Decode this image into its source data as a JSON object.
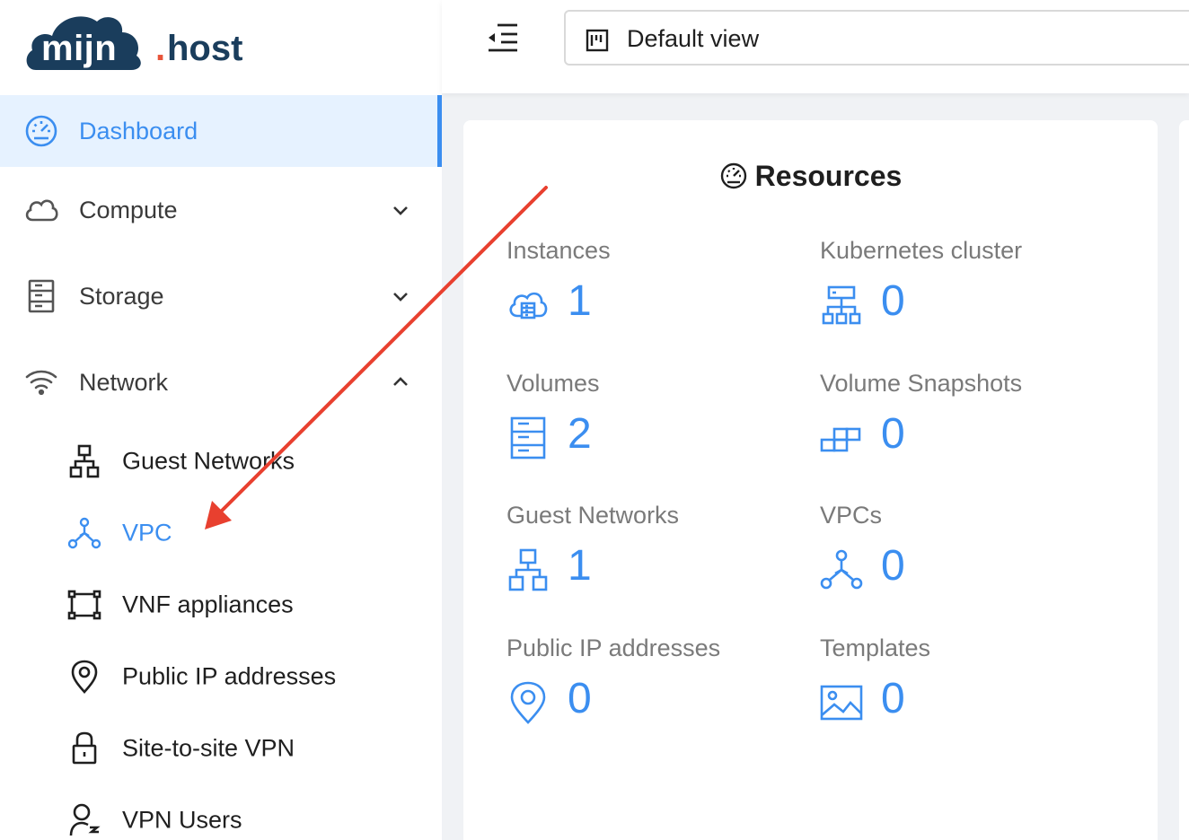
{
  "brand": {
    "part1": "mijn",
    "dot": ".",
    "part2": "host"
  },
  "sidebar": {
    "items": [
      {
        "label": "Dashboard"
      },
      {
        "label": "Compute"
      },
      {
        "label": "Storage"
      },
      {
        "label": "Network"
      }
    ],
    "network_sub": [
      {
        "label": "Guest Networks"
      },
      {
        "label": "VPC"
      },
      {
        "label": "VNF appliances"
      },
      {
        "label": "Public IP addresses"
      },
      {
        "label": "Site-to-site VPN"
      },
      {
        "label": "VPN Users"
      }
    ]
  },
  "header": {
    "view_label": "Default view"
  },
  "resources": {
    "title": "Resources",
    "stats": [
      {
        "label": "Instances",
        "value": "1"
      },
      {
        "label": "Kubernetes cluster",
        "value": "0"
      },
      {
        "label": "Volumes",
        "value": "2"
      },
      {
        "label": "Volume Snapshots",
        "value": "0"
      },
      {
        "label": "Guest Networks",
        "value": "1"
      },
      {
        "label": "VPCs",
        "value": "0"
      },
      {
        "label": "Public IP addresses",
        "value": "0"
      },
      {
        "label": "Templates",
        "value": "0"
      }
    ]
  },
  "colors": {
    "accent": "#3b8ef0",
    "brand_dark": "#1a3d5c",
    "brand_dot": "#e8543a",
    "annotation_arrow": "#e8402f"
  }
}
